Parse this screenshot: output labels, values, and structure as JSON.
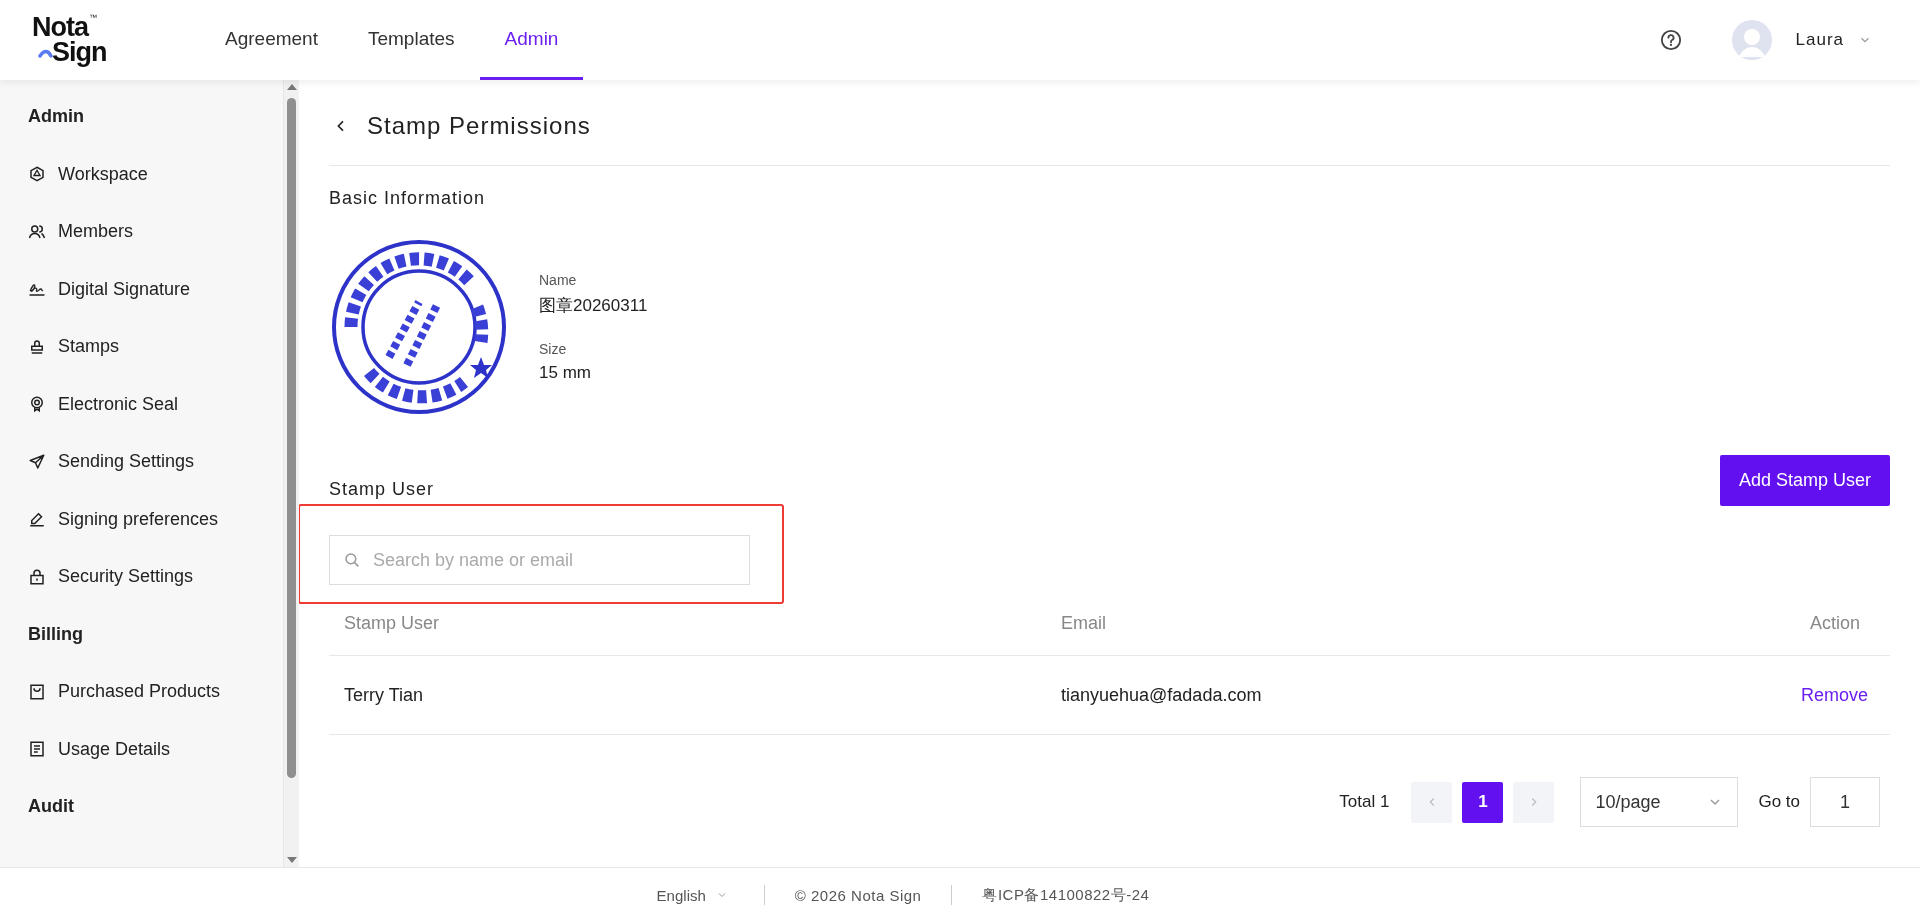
{
  "header": {
    "logo": {
      "top": "Nota",
      "bottom": "Sign",
      "mark": "™"
    },
    "nav": [
      {
        "label": "Agreement",
        "selected": false
      },
      {
        "label": "Templates",
        "selected": false
      },
      {
        "label": "Admin",
        "selected": true
      }
    ],
    "user": {
      "name": "Laura"
    }
  },
  "sidebar": {
    "sections": [
      {
        "title": "Admin",
        "items": [
          {
            "label": "Workspace",
            "selected": false
          },
          {
            "label": "Members",
            "selected": false
          },
          {
            "label": "Digital Signature",
            "selected": false
          },
          {
            "label": "Stamps",
            "selected": false
          },
          {
            "label": "Electronic Seal",
            "selected": false
          },
          {
            "label": "Sending Settings",
            "selected": false
          },
          {
            "label": "Signing preferences",
            "selected": false
          },
          {
            "label": "Security Settings",
            "selected": false
          }
        ]
      },
      {
        "title": "Billing",
        "items": [
          {
            "label": "Purchased Products",
            "selected": false
          },
          {
            "label": "Usage Details",
            "selected": false
          }
        ]
      },
      {
        "title": "Audit"
      }
    ]
  },
  "page": {
    "title": "Stamp Permissions",
    "basic_info": {
      "heading": "Basic Information",
      "fields": [
        {
          "label": "Name",
          "value": "图章20260311"
        },
        {
          "label": "Size",
          "value": "15 mm"
        }
      ]
    },
    "stamp_users": {
      "heading": "Stamp User",
      "add_button": "Add Stamp User",
      "search": {
        "placeholder": "Search by name or email",
        "highlighted": true
      },
      "table": {
        "columns": [
          "Stamp User",
          "Email",
          "Action"
        ],
        "rows": [
          {
            "user": "Terry Tian",
            "email": "tianyuehua@fadada.com",
            "action": "Remove"
          }
        ]
      },
      "pagination": {
        "total": "Total 1",
        "pages": [
          {
            "label": "1",
            "selected": true
          }
        ],
        "page_size": "10/page",
        "goto_label": "Go to",
        "goto_value": "1"
      }
    }
  },
  "footer": {
    "language": "English",
    "copyright": "© 2026 Nota Sign",
    "icp": "粤ICP备14100822号-24"
  }
}
